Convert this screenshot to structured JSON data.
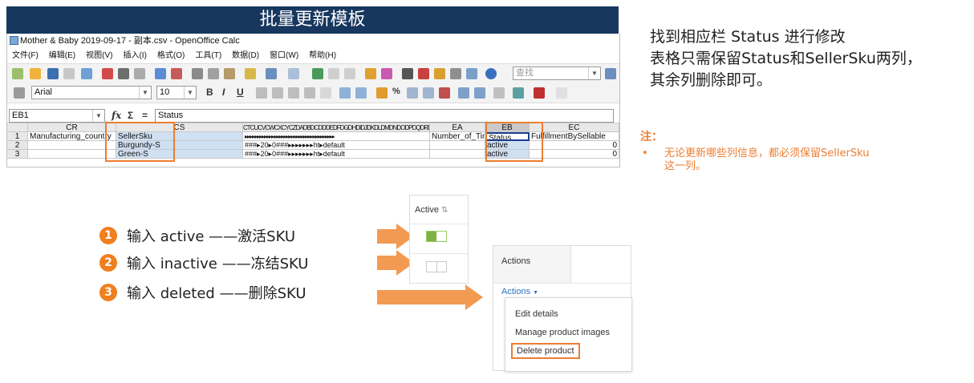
{
  "banner_title": "批量更新模板",
  "calc": {
    "window_title": "Mother & Baby 2019-09-17 - 副本.csv - OpenOffice Calc",
    "menu": [
      "文件(F)",
      "编辑(E)",
      "视图(V)",
      "插入(I)",
      "格式(O)",
      "工具(T)",
      "数据(D)",
      "窗口(W)",
      "帮助(H)"
    ],
    "find_placeholder": "查找",
    "font_name": "Arial",
    "font_size": "10",
    "name_box": "EB1",
    "formula_value": "Status",
    "function_symbols": {
      "fx": "fx",
      "sigma": "Σ",
      "equals": "="
    },
    "col_headers": [
      "CR",
      "CS",
      "CTCUCVCWCXCYCZDADBDCDDDEDFDGDHDIDJDKDLDMDNDODPDQDRDSDTDUDVDWDXDYDZ",
      "EA",
      "EB",
      "EC"
    ],
    "row_numbers": [
      "1",
      "2",
      "3"
    ],
    "rows": [
      {
        "cr": "Manufacturing_country",
        "cs": "SellerSku",
        "mid": "▸▸▸▸▸▸▸▸▸▸▸▸▸▸▸▸▸▸▸▸▸▸▸▸▸▸▸▸▸▸▸▸▸▸▸▸▸",
        "ea": "Number_of_Tins",
        "eb": "Status",
        "ec": "FulfillmentBySellable"
      },
      {
        "cr": "",
        "cs": "Burgundy-S",
        "mid": "###▸20▸0###▸▸▸▸▸▸▸ht▸default",
        "ea": "",
        "eb": "active",
        "ec": "0"
      },
      {
        "cr": "",
        "cs": "Green-S",
        "mid": "###▸20▸0###▸▸▸▸▸▸▸ht▸default",
        "ea": "",
        "eb": "active",
        "ec": "0"
      }
    ]
  },
  "instructions": {
    "line1": "找到相应栏 Status 进行修改",
    "line2": "表格只需保留Status和SellerSku两列，",
    "line3": "其余列删除即可。"
  },
  "note": {
    "title": "注：",
    "bullet": "•",
    "text_line1": "无论更新哪些列信息，都必须保留SellerSku",
    "text_line2": "这一列。"
  },
  "steps": [
    {
      "num": "1",
      "text": "输入  active ——激活SKU"
    },
    {
      "num": "2",
      "text": "输入  inactive ——冻结SKU"
    },
    {
      "num": "3",
      "text": "输入  deleted ——删除SKU"
    }
  ],
  "active_panel": {
    "header": "Active",
    "sort_icon": "⇅"
  },
  "actions_panel": {
    "header": "Actions",
    "dropdown_label": "Actions",
    "items": [
      "Edit details",
      "Manage product images",
      "Delete product"
    ]
  },
  "colors": {
    "banner": "#17375e",
    "accent": "#ed7d31",
    "arrow": "#f39a52",
    "toggle_on": "#7cb342"
  }
}
